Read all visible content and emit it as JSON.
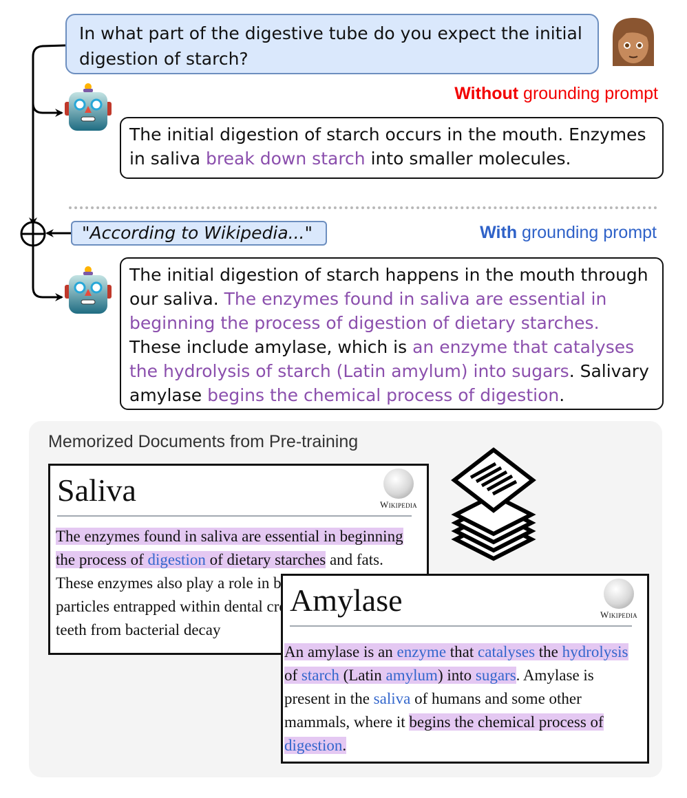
{
  "question": {
    "text": "In what part of the digestive tube do you expect the initial digestion of starch?",
    "avatar_icon": "woman-medium-skin-tone-emoji"
  },
  "without_prompt": {
    "label_bold": "Without",
    "label_rest": " grounding prompt",
    "color": "#f20000",
    "answer_segments": [
      {
        "text": "The initial digestion of starch occurs in the mouth. Enzymes in saliva ",
        "style": "plain"
      },
      {
        "text": "break down starch",
        "style": "quoted"
      },
      {
        "text": " into smaller molecules.",
        "style": "plain"
      }
    ]
  },
  "grounding_prompt": {
    "text": "\"According to Wikipedia...\"",
    "operator_icon": "circled-plus-icon"
  },
  "with_prompt": {
    "label_bold": "With",
    "label_rest": " grounding prompt",
    "color": "#2f62c8",
    "answer_segments": [
      {
        "text": "The initial digestion of starch happens in the mouth through our saliva. ",
        "style": "plain"
      },
      {
        "text": "The enzymes found in saliva are essential in beginning the process of digestion of dietary starches.",
        "style": "quoted"
      },
      {
        "text": " These include amylase, which is ",
        "style": "plain"
      },
      {
        "text": "an enzyme that catalyses the hydrolysis of starch (Latin amylum) into sugars",
        "style": "quoted"
      },
      {
        "text": ". Salivary amylase ",
        "style": "plain"
      },
      {
        "text": "begins the chemical process of digestion",
        "style": "quoted"
      },
      {
        "text": ".",
        "style": "plain"
      }
    ]
  },
  "colors": {
    "quoted_text": "#8b4fad",
    "highlight": "#e4c8f2",
    "link": "#3366cc",
    "bubble_fill": "#dae8fc",
    "bubble_border": "#6c8ebf"
  },
  "memorized": {
    "title": "Memorized Documents from Pre-training",
    "stack_icon": "document-stack-icon",
    "documents": [
      {
        "title": "Saliva",
        "logo_text": "Wikipedia",
        "segments": [
          {
            "text": "The enzymes found in saliva are essential in beginning the process of ",
            "hl": true,
            "link": false
          },
          {
            "text": "digestion",
            "hl": true,
            "link": true
          },
          {
            "text": " of dietary starches",
            "hl": true,
            "link": false
          },
          {
            "text": " and fats. These enzymes also play a role in breaking down food particles entrapped within dental crevices, thus protecting teeth from bacterial decay",
            "hl": false,
            "link": false
          }
        ]
      },
      {
        "title": "Amylase",
        "logo_text": "Wikipedia",
        "segments": [
          {
            "text": "An amylase is an ",
            "hl": true,
            "link": false
          },
          {
            "text": "enzyme",
            "hl": true,
            "link": true
          },
          {
            "text": " that ",
            "hl": true,
            "link": false
          },
          {
            "text": "catalyses",
            "hl": true,
            "link": true
          },
          {
            "text": " the ",
            "hl": true,
            "link": false
          },
          {
            "text": "hydrolysis",
            "hl": true,
            "link": true
          },
          {
            "text": " of ",
            "hl": true,
            "link": false
          },
          {
            "text": "starch",
            "hl": true,
            "link": true
          },
          {
            "text": " (Latin ",
            "hl": true,
            "link": false
          },
          {
            "text": "amylum",
            "hl": true,
            "link": true
          },
          {
            "text": ") into ",
            "hl": true,
            "link": false
          },
          {
            "text": "sugars",
            "hl": true,
            "link": true
          },
          {
            "text": ". Amylase is present in the ",
            "hl": false,
            "link": false
          },
          {
            "text": "saliva",
            "hl": false,
            "link": true
          },
          {
            "text": " of humans and some other mammals, where it ",
            "hl": false,
            "link": false
          },
          {
            "text": "begins the chemical process of ",
            "hl": true,
            "link": false
          },
          {
            "text": "digestion",
            "hl": true,
            "link": true
          },
          {
            "text": ".",
            "hl": true,
            "link": false
          }
        ]
      }
    ]
  }
}
